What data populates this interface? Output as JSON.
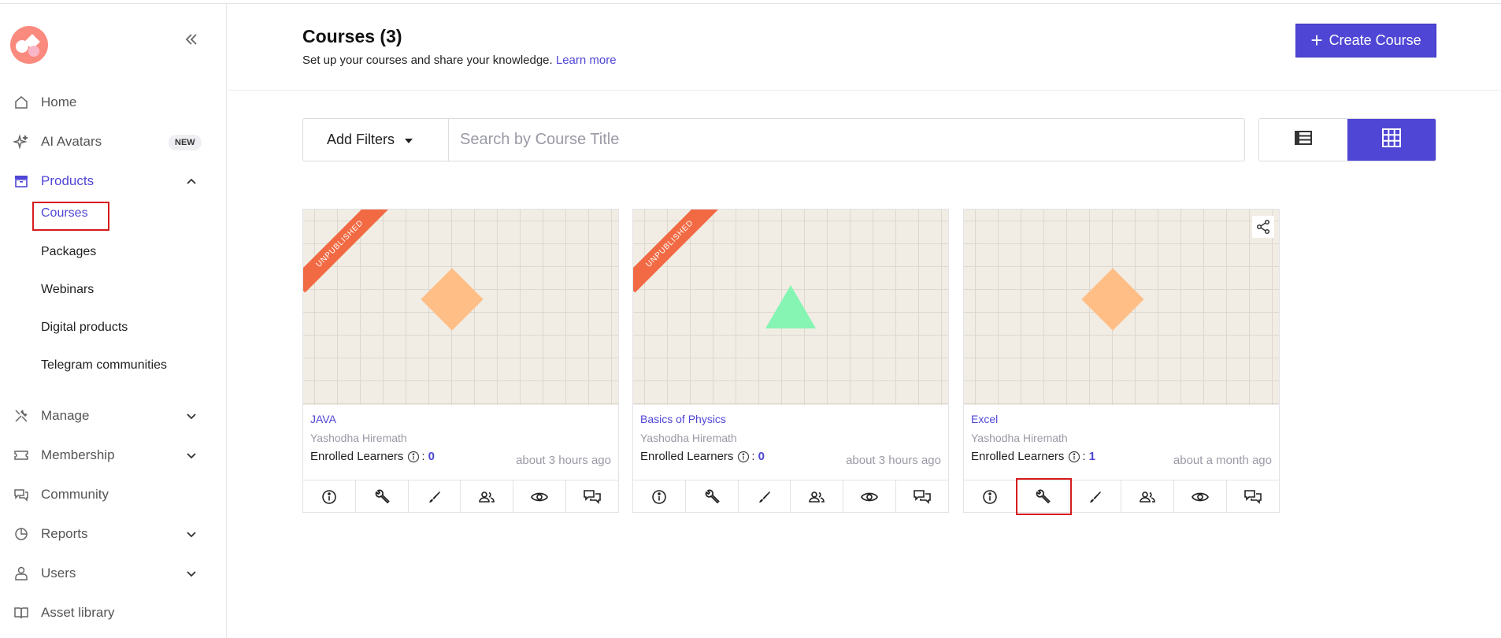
{
  "sidebar": {
    "logo_icon": "brand-logo",
    "collapse_icon": "double-chevron-left-icon",
    "items": [
      {
        "label": "Home",
        "icon": "home-icon"
      },
      {
        "label": "AI Avatars",
        "icon": "sparkle-icon",
        "badge": "NEW"
      },
      {
        "label": "Products",
        "icon": "archive-box-icon",
        "expanded": true
      },
      {
        "label": "Manage",
        "icon": "tools-icon"
      },
      {
        "label": "Membership",
        "icon": "ticket-icon"
      },
      {
        "label": "Community",
        "icon": "chat-icon"
      },
      {
        "label": "Reports",
        "icon": "pie-chart-icon"
      },
      {
        "label": "Users",
        "icon": "user-icon"
      },
      {
        "label": "Asset library",
        "icon": "book-icon"
      }
    ],
    "products_sub": [
      "Courses",
      "Packages",
      "Webinars",
      "Digital products",
      "Telegram communities"
    ]
  },
  "header": {
    "title": "Courses (3)",
    "subtitle": "Set up your courses and share your knowledge.",
    "learn_more": "Learn more",
    "create_button": "Create Course"
  },
  "filters": {
    "add_filters": "Add Filters",
    "search_placeholder": "Search by Course Title"
  },
  "courses": [
    {
      "title": "JAVA",
      "author": "Yashodha Hiremath",
      "enrolled_label": "Enrolled Learners",
      "enrolled_count": "0",
      "time": "about 3 hours ago",
      "status": "UNPUBLISHED",
      "shape": "diamond"
    },
    {
      "title": "Basics of Physics",
      "author": "Yashodha Hiremath",
      "enrolled_label": "Enrolled Learners",
      "enrolled_count": "0",
      "time": "about 3 hours ago",
      "status": "UNPUBLISHED",
      "shape": "triangle"
    },
    {
      "title": "Excel",
      "author": "Yashodha Hiremath",
      "enrolled_label": "Enrolled Learners",
      "enrolled_count": "1",
      "time": "about a month ago",
      "status": "",
      "shape": "diamond"
    }
  ],
  "card_actions": [
    "info-icon",
    "wrench-icon",
    "brush-icon",
    "users-icon",
    "eye-icon",
    "chat-bubbles-icon"
  ],
  "colors": {
    "accent": "#4f46d5",
    "ribbon": "#f26a43",
    "diamond": "#ffbe86",
    "triangle": "#86f5b4",
    "highlight": "#d61c1c"
  }
}
